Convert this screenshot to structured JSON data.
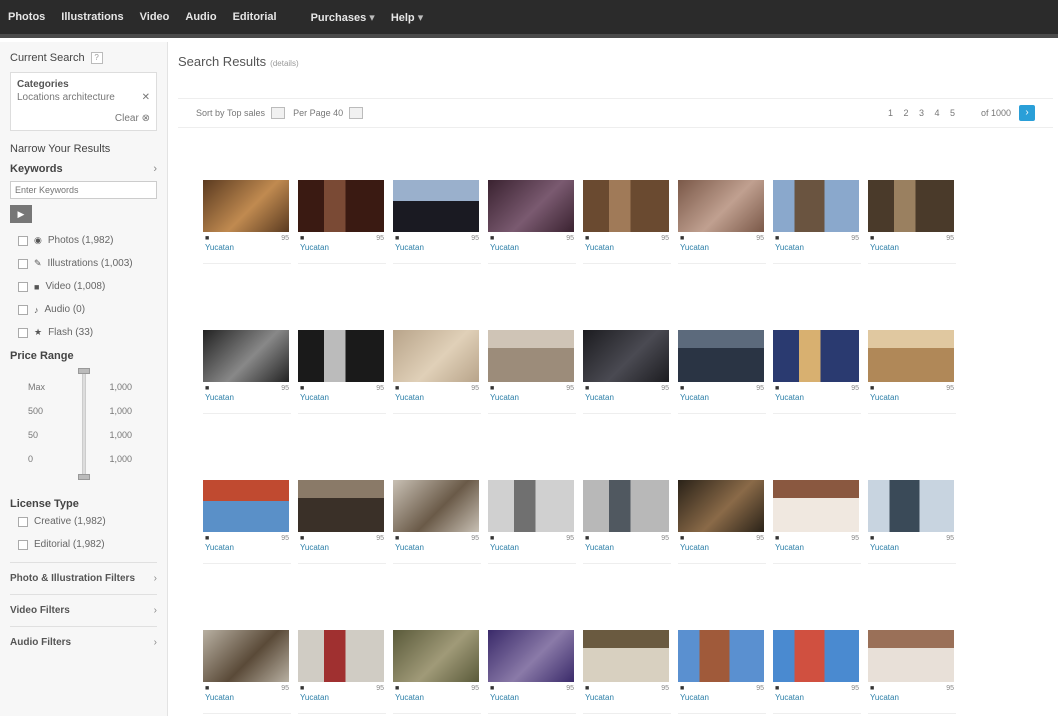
{
  "nav": {
    "items": [
      "Photos",
      "Illustrations",
      "Video",
      "Audio",
      "Editorial"
    ],
    "right_items": [
      "Purchases",
      "Help"
    ]
  },
  "sidebar": {
    "current_search": "Current Search",
    "categories_label": "Categories",
    "categories_value": "Locations architecture",
    "clear": "Clear",
    "narrow": "Narrow Your Results",
    "keywords": "Keywords",
    "keyword_placeholder": "Enter Keywords",
    "media_types": [
      {
        "icon": "camera-icon",
        "label": "Photos (1,982)"
      },
      {
        "icon": "pen-icon",
        "label": "Illustrations (1,003)"
      },
      {
        "icon": "video-icon",
        "label": "Video (1,008)"
      },
      {
        "icon": "music-icon",
        "label": "Audio (0)"
      },
      {
        "icon": "star-icon",
        "label": "Flash (33)"
      }
    ],
    "price_range": "Price Range",
    "price_rows": [
      {
        "left": "Max",
        "right": "1,000"
      },
      {
        "left": "500",
        "right": "1,000"
      },
      {
        "left": "50",
        "right": "1,000"
      },
      {
        "left": "0",
        "right": "1,000"
      }
    ],
    "license_type": "License Type",
    "licenses": [
      "Creative (1,982)",
      "Editorial (1,982)"
    ],
    "filters": [
      "Photo & Illustration Filters",
      "Video Filters",
      "Audio Filters"
    ]
  },
  "main": {
    "title": "Search Results",
    "subtitle": "(details)",
    "sort_label": "Sort by",
    "sort_value": "Top sales",
    "per_page_label": "Per Page",
    "per_page_value": "40",
    "pages": "1 2 3 4 5",
    "go_label": "of 1000",
    "next_icon": "next-arrow-icon"
  },
  "tiles": [
    {
      "name": "Yucatan",
      "count": "95",
      "c1": "#5a3a20",
      "c2": "#c08a50",
      "kind": "diag"
    },
    {
      "name": "Yucatan",
      "count": "95",
      "c1": "#3a1a12",
      "c2": "#7a4a35",
      "kind": "door"
    },
    {
      "name": "Yucatan",
      "count": "95",
      "c1": "#1a1a22",
      "c2": "#9ab0cc",
      "kind": "vsky"
    },
    {
      "name": "Yucatan",
      "count": "95",
      "c1": "#3a2230",
      "c2": "#7a5a70",
      "kind": "diag"
    },
    {
      "name": "Yucatan",
      "count": "95",
      "c1": "#6a4a30",
      "c2": "#a07a58",
      "kind": "door"
    },
    {
      "name": "Yucatan",
      "count": "95",
      "c1": "#7a5848",
      "c2": "#c0a090",
      "kind": "diag"
    },
    {
      "name": "Yucatan",
      "count": "95",
      "c1": "#8aa8cc",
      "c2": "#6a5440",
      "kind": "tower"
    },
    {
      "name": "Yucatan",
      "count": "95",
      "c1": "#4a3a2a",
      "c2": "#9a8060",
      "kind": "door"
    },
    {
      "name": "Yucatan",
      "count": "95",
      "c1": "#222",
      "c2": "#888",
      "kind": "diag"
    },
    {
      "name": "Yucatan",
      "count": "95",
      "c1": "#1a1a1a",
      "c2": "#bbb",
      "kind": "door"
    },
    {
      "name": "Yucatan",
      "count": "95",
      "c1": "#b8a48a",
      "c2": "#e0d0b8",
      "kind": "diag"
    },
    {
      "name": "Yucatan",
      "count": "95",
      "c1": "#9c8c7a",
      "c2": "#cfc4b6",
      "kind": "wall"
    },
    {
      "name": "Yucatan",
      "count": "95",
      "c1": "#1c1c20",
      "c2": "#4a4a52",
      "kind": "diag"
    },
    {
      "name": "Yucatan",
      "count": "95",
      "c1": "#2a3444",
      "c2": "#5c6a7c",
      "kind": "wall"
    },
    {
      "name": "Yucatan",
      "count": "95",
      "c1": "#2a3a70",
      "c2": "#d8b070",
      "kind": "door"
    },
    {
      "name": "Yucatan",
      "count": "95",
      "c1": "#b08858",
      "c2": "#e0c8a0",
      "kind": "wall"
    },
    {
      "name": "Yucatan",
      "count": "95",
      "c1": "#5a90c8",
      "c2": "#c04a30",
      "kind": "vsky"
    },
    {
      "name": "Yucatan",
      "count": "95",
      "c1": "#3a3028",
      "c2": "#8a7a68",
      "kind": "wall"
    },
    {
      "name": "Yucatan",
      "count": "95",
      "c1": "#c8c0b4",
      "c2": "#6a5a48",
      "kind": "diag"
    },
    {
      "name": "Yucatan",
      "count": "95",
      "c1": "#d0d0d0",
      "c2": "#707070",
      "kind": "door"
    },
    {
      "name": "Yucatan",
      "count": "95",
      "c1": "#b8b8b8",
      "c2": "#505860",
      "kind": "door"
    },
    {
      "name": "Yucatan",
      "count": "95",
      "c1": "#2a2218",
      "c2": "#8a6a48",
      "kind": "diag"
    },
    {
      "name": "Yucatan",
      "count": "95",
      "c1": "#f0e8e0",
      "c2": "#8a5840",
      "kind": "wall"
    },
    {
      "name": "Yucatan",
      "count": "95",
      "c1": "#c8d4e0",
      "c2": "#3a4a58",
      "kind": "tower"
    },
    {
      "name": "Yucatan",
      "count": "95",
      "c1": "#b8b0a2",
      "c2": "#5a4a38",
      "kind": "diag"
    },
    {
      "name": "Yucatan",
      "count": "95",
      "c1": "#d0ccc4",
      "c2": "#a03030",
      "kind": "door"
    },
    {
      "name": "Yucatan",
      "count": "95",
      "c1": "#5a5a3a",
      "c2": "#a09a78",
      "kind": "diag"
    },
    {
      "name": "Yucatan",
      "count": "95",
      "c1": "#3a2a6a",
      "c2": "#8a7aa8",
      "kind": "diag"
    },
    {
      "name": "Yucatan",
      "count": "95",
      "c1": "#d8d0c0",
      "c2": "#6a5a40",
      "kind": "wall"
    },
    {
      "name": "Yucatan",
      "count": "95",
      "c1": "#5a90d0",
      "c2": "#a05a3a",
      "kind": "tower"
    },
    {
      "name": "Yucatan",
      "count": "95",
      "c1": "#4a8ad0",
      "c2": "#d05040",
      "kind": "tower"
    },
    {
      "name": "Yucatan",
      "count": "95",
      "c1": "#e8e0d8",
      "c2": "#9a7058",
      "kind": "wall"
    }
  ]
}
